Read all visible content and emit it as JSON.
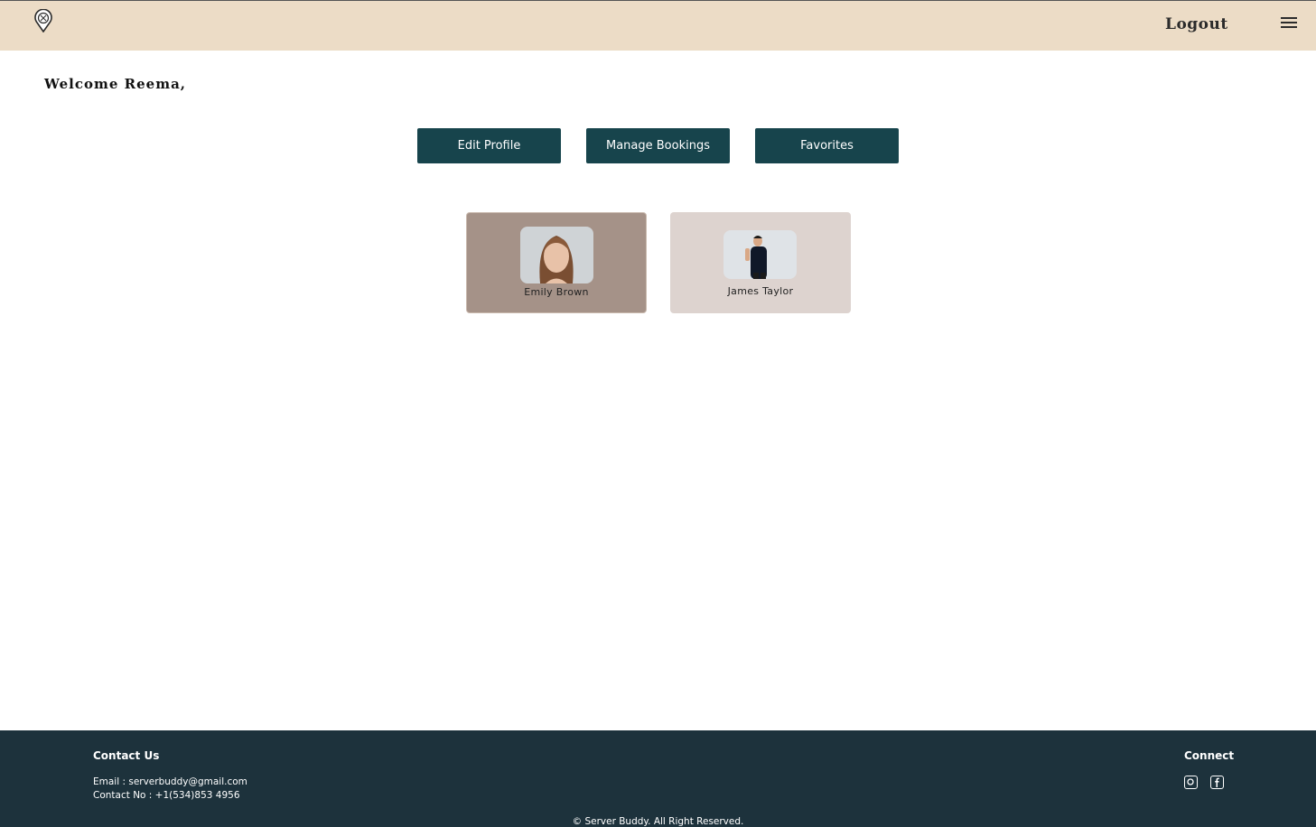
{
  "header": {
    "logout_label": "Logout"
  },
  "welcome": {
    "text": "Welcome Reema,"
  },
  "actions": {
    "edit_profile": "Edit Profile",
    "manage_bookings": "Manage Bookings",
    "favorites": "Favorites"
  },
  "servers": [
    {
      "name": "Emily Brown"
    },
    {
      "name": "James Taylor"
    }
  ],
  "footer": {
    "contact_title": "Contact Us",
    "email": "Email : serverbuddy@gmail.com",
    "phone": "Contact No : +1(534)853 4956",
    "connect_title": "Connect",
    "copyright": "© Server Buddy. All Right Reserved."
  },
  "colors": {
    "header_bg": "#ecdcc6",
    "button_bg": "#17444c",
    "footer_bg": "#1d323c",
    "card_selected_bg": "#a59288",
    "card_bg": "#ddd3cf"
  }
}
